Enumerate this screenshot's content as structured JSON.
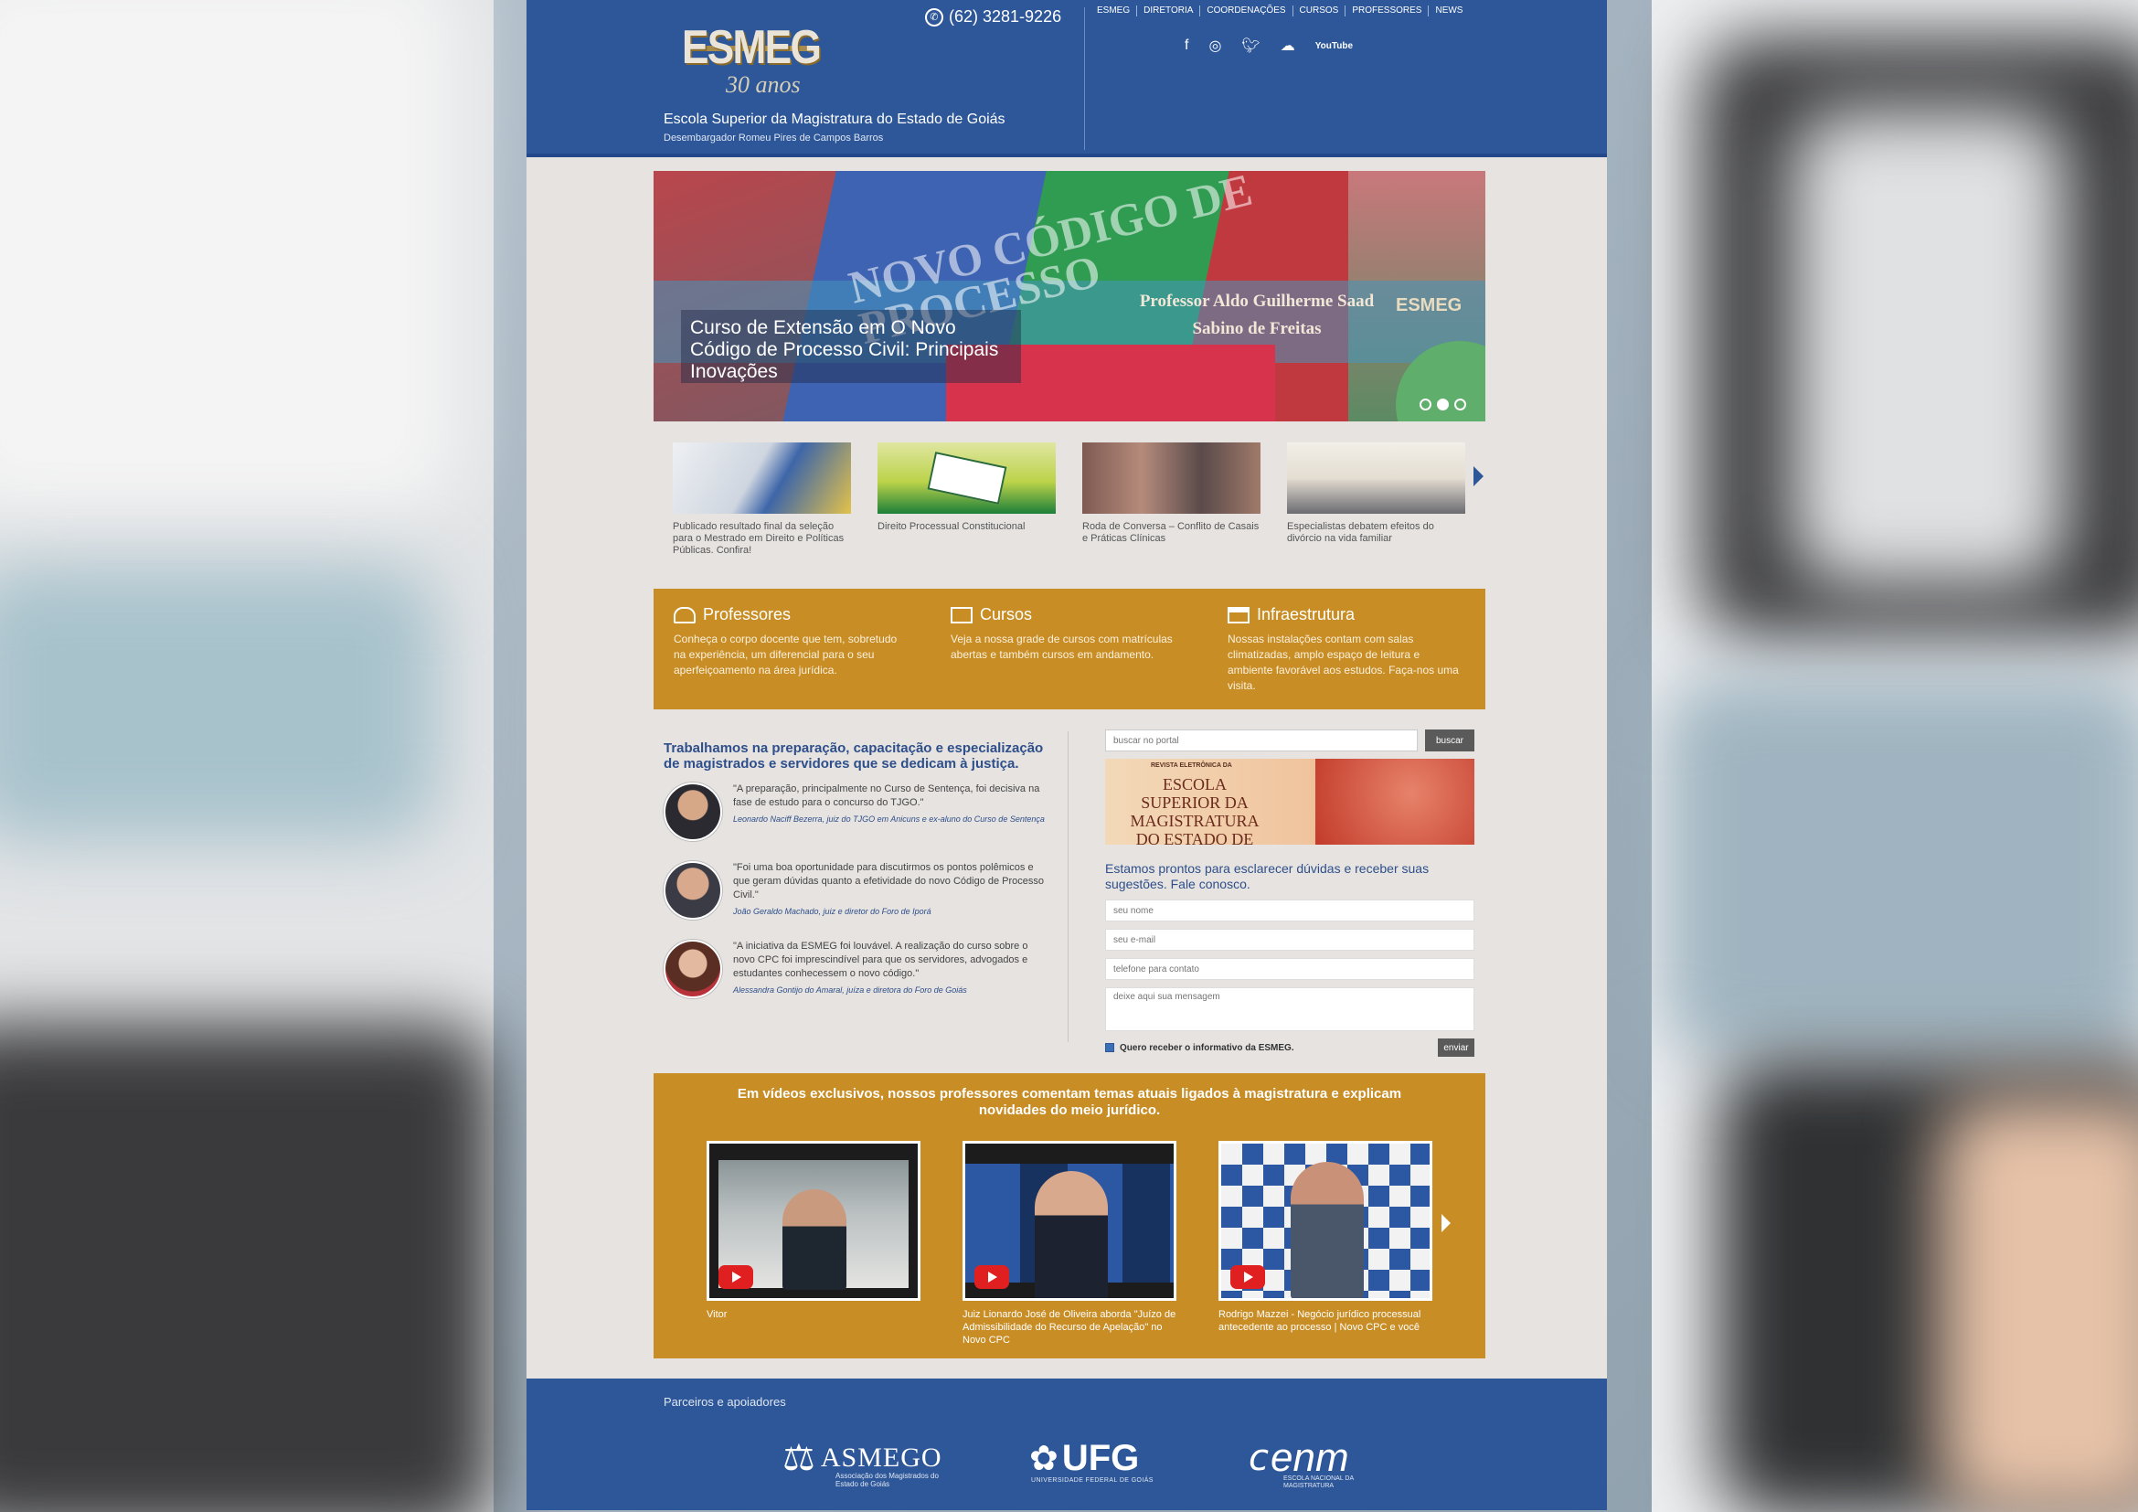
{
  "header": {
    "logo_main": "ESMEG",
    "logo_sub": "30 anos",
    "phone": "(62) 3281-9226",
    "school_title": "Escola Superior da Magistratura do Estado de Goiás",
    "school_sub": "Desembargador Romeu Pires de Campos Barros",
    "nav": [
      "ESMEG",
      "DIRETORIA",
      "COORDENAÇÕES",
      "CURSOS",
      "PROFESSORES",
      "NEWS"
    ],
    "social_icons": [
      "facebook-icon",
      "instagram-icon",
      "twitter-icon",
      "soundcloud-icon",
      "youtube-icon"
    ],
    "youtube_label": "YouTube"
  },
  "slider": {
    "caption": "Curso de Extensão em O Novo Código de Processo Civil: Principais Inovações",
    "bg_text": "NOVO CÓDIGO DE PROCESSO",
    "professor": "Professor Aldo Guilherme Saad Sabino de Freitas",
    "brand": "ESMEG",
    "dots": 3,
    "active_dot": 1
  },
  "thumbs": [
    {
      "caption": "Publicado resultado final da seleção para o Mestrado em Direito e Políticas Públicas. Confira!"
    },
    {
      "caption": "Direito Processual Constitucional"
    },
    {
      "caption": "Roda de Conversa – Conflito de Casais e Práticas Clínicas"
    },
    {
      "caption": "Especialistas debatem efeitos do divórcio na vida familiar"
    }
  ],
  "features": [
    {
      "title": "Professores",
      "body": "Conheça o corpo docente que tem, sobretudo na experiência, um diferencial para o seu aperfeiçoamento na área jurídica."
    },
    {
      "title": "Cursos",
      "body": "Veja a nossa grade de cursos com matrículas abertas e também cursos em andamento."
    },
    {
      "title": "Infraestrutura",
      "body": "Nossas instalações contam com salas climatizadas, amplo espaço de leitura e ambiente favorável aos estudos. Faça-nos uma visita."
    }
  ],
  "intro": "Trabalhamos na preparação, capacitação e especialização de magistrados e servidores que se dedicam à justiça.",
  "testimonials": [
    {
      "quote": "\"A preparação, principalmente no Curso de Sentença, foi decisiva na fase de estudo para o concurso do TJGO.\"",
      "author": "Leonardo Naciff Bezerra, juiz do TJGO em Anicuns e ex-aluno do Curso de Sentença"
    },
    {
      "quote": "\"Foi uma boa oportunidade para discutirmos os pontos polêmicos e que geram dúvidas quanto a efetividade do novo Código de Processo Civil.\"",
      "author": "João Geraldo Machado, juiz e diretor do Foro de Iporá"
    },
    {
      "quote": "\"A iniciativa da ESMEG foi louvável. A realização do curso sobre o novo CPC foi imprescindível para que os servidores, advogados e estudantes conhecessem o novo código.\"",
      "author": "Alessandra Gontijo do Amaral, juíza e diretora do Foro de Goiás"
    }
  ],
  "search": {
    "placeholder": "buscar no portal",
    "button": "buscar"
  },
  "banner": {
    "top": "REVISTA ELETRÔNICA DA",
    "text": "ESCOLA SUPERIOR DA MAGISTRATURA DO ESTADO DE GOIÁS"
  },
  "contact": {
    "intro": "Estamos prontos para esclarecer dúvidas e receber suas sugestões. Fale conosco.",
    "name_placeholder": "seu nome",
    "email_placeholder": "seu e-mail",
    "phone_placeholder": "telefone para contato",
    "message_placeholder": "deixe aqui sua mensagem",
    "newsletter_label": "Quero receber o informativo da ESMEG.",
    "send": "enviar"
  },
  "videos": {
    "heading": "Em vídeos exclusivos, nossos professores comentam temas atuais ligados à magistratura e explicam novidades do meio jurídico.",
    "items": [
      {
        "caption": "Vitor"
      },
      {
        "caption": "Juiz Lionardo José de Oliveira aborda \"Juízo de Admissibilidade do Recurso de Apelação\" no Novo CPC"
      },
      {
        "caption": "Rodrigo Mazzei - Negócio jurídico processual antecedente ao processo | Novo CPC e você"
      }
    ]
  },
  "footer": {
    "title": "Parceiros e apoiadores",
    "partners": [
      {
        "name": "ASMEGO",
        "sub": "Associação dos Magistrados do Estado de Goiás"
      },
      {
        "name": "UFG",
        "sub": "UNIVERSIDADE FEDERAL DE GOIÁS"
      },
      {
        "name": "enm",
        "sub": "ESCOLA NACIONAL DA MAGISTRATURA"
      }
    ]
  },
  "colors": {
    "blue": "#2d5798",
    "orange": "#c88d25",
    "page_bg": "#e6e3e1"
  }
}
